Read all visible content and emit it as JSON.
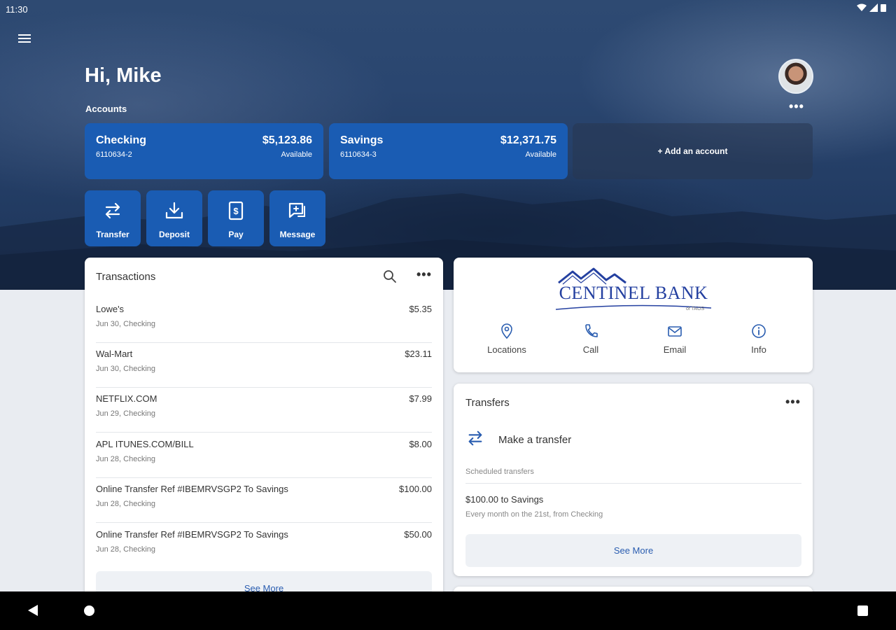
{
  "status_bar": {
    "time": "11:30"
  },
  "greeting": "Hi, Mike",
  "accounts_label": "Accounts",
  "accounts": [
    {
      "name": "Checking",
      "number": "6110634-2",
      "balance": "$5,123.86",
      "balance_label": "Available"
    },
    {
      "name": "Savings",
      "number": "6110634-3",
      "balance": "$12,371.75",
      "balance_label": "Available"
    }
  ],
  "add_account_label": "+ Add an account",
  "quick_actions": [
    {
      "label": "Transfer",
      "icon": "transfer-icon"
    },
    {
      "label": "Deposit",
      "icon": "deposit-icon"
    },
    {
      "label": "Pay",
      "icon": "pay-icon"
    },
    {
      "label": "Message",
      "icon": "message-icon"
    }
  ],
  "transactions": {
    "title": "Transactions",
    "items": [
      {
        "description": "Lowe's",
        "meta": "Jun 30, Checking",
        "amount": "$5.35"
      },
      {
        "description": "Wal-Mart",
        "meta": "Jun 30, Checking",
        "amount": "$23.11"
      },
      {
        "description": "NETFLIX.COM",
        "meta": "Jun 29, Checking",
        "amount": "$7.99"
      },
      {
        "description": "APL ITUNES.COM/BILL",
        "meta": "Jun 28, Checking",
        "amount": "$8.00"
      },
      {
        "description": "Online Transfer Ref #IBEMRVSGP2 To Savings",
        "meta": "Jun 28, Checking",
        "amount": "$100.00"
      },
      {
        "description": "Online Transfer Ref #IBEMRVSGP2 To Savings",
        "meta": "Jun 28, Checking",
        "amount": "$50.00"
      }
    ],
    "see_more": "See More"
  },
  "bank": {
    "name": "CENTINEL BANK",
    "sub": "of TAOS",
    "actions": [
      {
        "label": "Locations",
        "icon": "location-pin-icon"
      },
      {
        "label": "Call",
        "icon": "phone-icon"
      },
      {
        "label": "Email",
        "icon": "email-icon"
      },
      {
        "label": "Info",
        "icon": "info-icon"
      }
    ]
  },
  "transfers": {
    "title": "Transfers",
    "make_transfer": "Make a transfer",
    "scheduled_label": "Scheduled transfers",
    "scheduled": [
      {
        "title": "$100.00 to Savings",
        "detail": "Every month on the 21st, from Checking"
      }
    ],
    "see_more": "See More"
  },
  "colors": {
    "accent": "#1a5cb3",
    "link": "#2a5db0",
    "bank_blue": "#2440a0"
  }
}
